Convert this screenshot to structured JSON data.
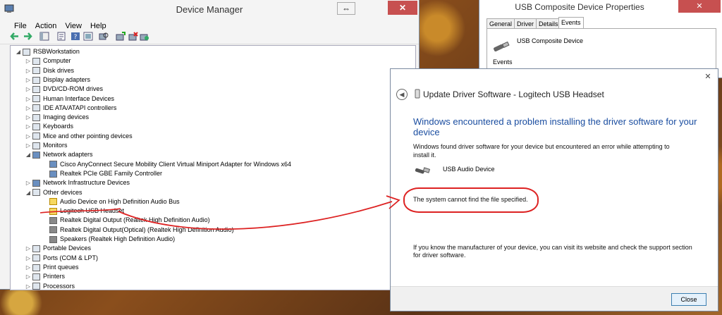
{
  "device_manager": {
    "title": "Device Manager",
    "controls": {
      "restore": "⇔",
      "close": "✕"
    },
    "menu": [
      "File",
      "Action",
      "View",
      "Help"
    ],
    "tree": [
      {
        "label": "RSBWorkstation",
        "level": 0,
        "toggle": "◢",
        "icon": "computer-icon"
      },
      {
        "label": "Computer",
        "level": 1,
        "toggle": "▷",
        "icon": "computer-icon"
      },
      {
        "label": "Disk drives",
        "level": 1,
        "toggle": "▷",
        "icon": "disk-icon"
      },
      {
        "label": "Display adapters",
        "level": 1,
        "toggle": "▷",
        "icon": "display-icon"
      },
      {
        "label": "DVD/CD-ROM drives",
        "level": 1,
        "toggle": "▷",
        "icon": "dvd-icon"
      },
      {
        "label": "Human Interface Devices",
        "level": 1,
        "toggle": "▷",
        "icon": "hid-icon"
      },
      {
        "label": "IDE ATA/ATAPI controllers",
        "level": 1,
        "toggle": "▷",
        "icon": "ide-icon"
      },
      {
        "label": "Imaging devices",
        "level": 1,
        "toggle": "▷",
        "icon": "camera-icon"
      },
      {
        "label": "Keyboards",
        "level": 1,
        "toggle": "▷",
        "icon": "keyboard-icon"
      },
      {
        "label": "Mice and other pointing devices",
        "level": 1,
        "toggle": "▷",
        "icon": "mouse-icon"
      },
      {
        "label": "Monitors",
        "level": 1,
        "toggle": "▷",
        "icon": "monitor-icon"
      },
      {
        "label": "Network adapters",
        "level": 1,
        "toggle": "◢",
        "icon": "network-icon"
      },
      {
        "label": "Cisco AnyConnect Secure Mobility Client Virtual Miniport Adapter for Windows x64",
        "level": 2,
        "toggle": "",
        "icon": "network-icon"
      },
      {
        "label": "Realtek PCIe GBE Family Controller",
        "level": 2,
        "toggle": "",
        "icon": "network-icon"
      },
      {
        "label": "Network Infrastructure Devices",
        "level": 1,
        "toggle": "▷",
        "icon": "network-icon"
      },
      {
        "label": "Other devices",
        "level": 1,
        "toggle": "◢",
        "icon": "other-icon"
      },
      {
        "label": "Audio Device on High Definition Audio Bus",
        "level": 2,
        "toggle": "",
        "icon": "warning-icon"
      },
      {
        "label": "Logitech USB Headset",
        "level": 2,
        "toggle": "",
        "icon": "warning-icon"
      },
      {
        "label": "Realtek Digital Output (Realtek High Definition Audio)",
        "level": 2,
        "toggle": "",
        "icon": "speaker-icon"
      },
      {
        "label": "Realtek Digital Output(Optical) (Realtek High Definition Audio)",
        "level": 2,
        "toggle": "",
        "icon": "speaker-icon"
      },
      {
        "label": "Speakers (Realtek High Definition Audio)",
        "level": 2,
        "toggle": "",
        "icon": "speaker-icon"
      },
      {
        "label": "Portable Devices",
        "level": 1,
        "toggle": "▷",
        "icon": "portable-icon"
      },
      {
        "label": "Ports (COM & LPT)",
        "level": 1,
        "toggle": "▷",
        "icon": "port-icon"
      },
      {
        "label": "Print queues",
        "level": 1,
        "toggle": "▷",
        "icon": "printer-icon"
      },
      {
        "label": "Printers",
        "level": 1,
        "toggle": "▷",
        "icon": "printer-icon"
      },
      {
        "label": "Processors",
        "level": 1,
        "toggle": "▷",
        "icon": "cpu-icon"
      }
    ]
  },
  "properties": {
    "title": "USB Composite Device Properties",
    "tabs": [
      "General",
      "Driver",
      "Details",
      "Events"
    ],
    "active_tab": "Events",
    "device_name": "USB Composite Device",
    "section_label": "Events"
  },
  "update_driver": {
    "window_title": "Update Driver Software - Logitech USB Headset",
    "heading": "Windows encountered a problem installing the driver software for your device",
    "message": "Windows found driver software for your device but encountered an error while attempting to install it.",
    "device_name": "USB Audio Device",
    "error": "The system cannot find the file specified.",
    "footer_message": "If you know the manufacturer of your device, you can visit its website and check the support section for driver software.",
    "close_button": "Close",
    "close_x": "✕"
  },
  "colors": {
    "heading": "#1a4da0",
    "annotation": "#dd2222",
    "warning": "#f6d860"
  }
}
